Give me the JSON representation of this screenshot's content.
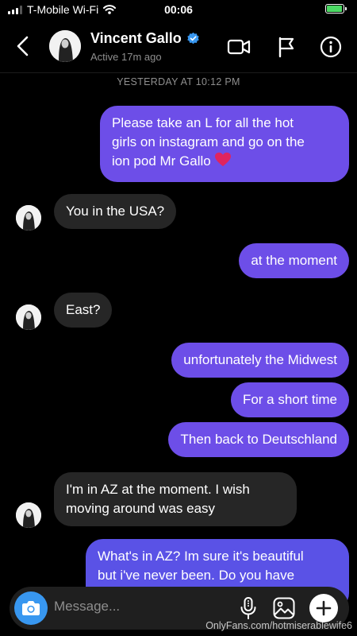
{
  "status_bar": {
    "carrier": "T-Mobile Wi-Fi",
    "time": "00:06",
    "battery_level": 0.95,
    "battery_charging": true
  },
  "header": {
    "name": "Vincent Gallo",
    "verified": true,
    "active_status": "Active 17m ago",
    "icons": [
      "back-chevron-icon",
      "video-call-icon",
      "flag-icon",
      "info-icon"
    ]
  },
  "thread": {
    "timestamp": "YESTERDAY AT 10:12 PM",
    "messages": [
      {
        "from": "me",
        "lines": [
          "Please take an L for all the hot",
          "girls on instagram and go on the",
          "ion pod Mr Gallo"
        ],
        "emoji": "red-heart"
      },
      {
        "from": "them",
        "lines": [
          "You in the USA?"
        ]
      },
      {
        "from": "me",
        "lines": [
          "at the moment"
        ]
      },
      {
        "from": "them",
        "lines": [
          "East?"
        ]
      },
      {
        "from": "me",
        "lines": [
          "unfortunately the Midwest"
        ]
      },
      {
        "from": "me",
        "lines": [
          "For a short time"
        ]
      },
      {
        "from": "me",
        "lines": [
          "Then back to Deutschland"
        ]
      },
      {
        "from": "them",
        "lines": [
          "I'm in AZ at the moment.  I wish",
          "moving around was easy"
        ]
      },
      {
        "from": "me",
        "lines": [
          "What's in AZ? Im sure it's beautiful",
          "but i've never been. Do you have"
        ]
      }
    ]
  },
  "composer": {
    "placeholder": "Message...",
    "icons": [
      "camera-icon",
      "microphone-icon",
      "gallery-icon",
      "plus-icon"
    ]
  },
  "watermark": "OnlyFans.com/hotmiserablewife6",
  "colors": {
    "sent_bubble": "#6d4ee8",
    "received_bubble": "#262626",
    "camera_button": "#3897f0",
    "verified_badge": "#3897f0",
    "heart": "#e0245e"
  }
}
